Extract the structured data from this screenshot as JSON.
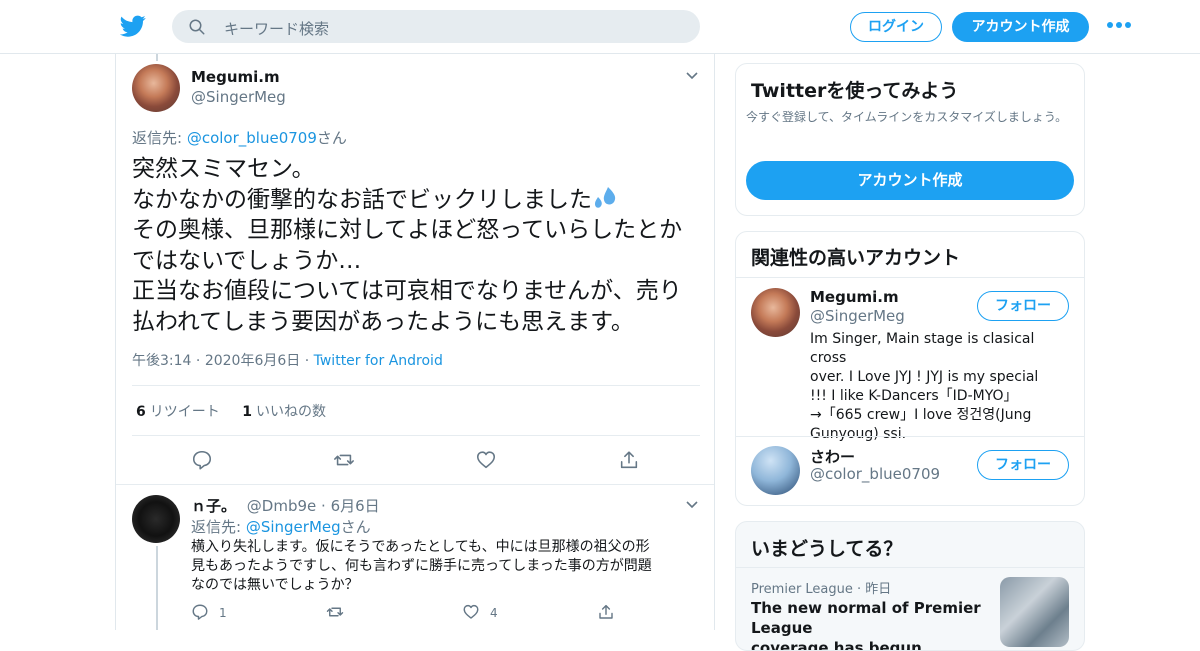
{
  "header": {
    "search_placeholder": "キーワード検索",
    "login_label": "ログイン",
    "signup_label": "アカウント作成",
    "brand_color": "#1da1f2"
  },
  "main_tweet": {
    "name": "Megumi.m",
    "handle": "@SingerMeg",
    "reply_prefix": "返信先: ",
    "reply_handle": "@color_blue0709",
    "reply_suffix": "さん",
    "lines": [
      "突然スミマセン。",
      "なかなかの衝撃的なお話でビックリしました",
      "その奥様、旦那様に対してよほど怒っていらしたとか",
      "ではないでしょうか…",
      "正当なお値段については可哀相でなりませんが、売り",
      "払われてしまう要因があったようにも思えます。"
    ],
    "time": "午後3:14",
    "date": "2020年6月6日",
    "source": "Twitter for Android",
    "retweet_count": "6",
    "retweet_label": "リツイート",
    "like_count": "1",
    "like_label": "いいねの数"
  },
  "reply_tweet": {
    "name": "ｎ子。",
    "handle": "@Dmb9e",
    "date": "6月6日",
    "reply_prefix": "返信先: ",
    "reply_handle": "@SingerMeg",
    "reply_suffix": "さん",
    "lines": [
      "横入り失礼します。仮にそうであったとしても、中には旦那様の祖父の形",
      "見もあったようですし、何も言わずに勝手に売ってしまった事の方が問題",
      "なのでは無いでしょうか？"
    ],
    "reply_count": "1",
    "like_count": "4"
  },
  "sidebar": {
    "try_twitter": {
      "title": "Twitterを使ってみよう",
      "subtitle": "今すぐ登録して、タイムラインをカスタマイズしましょう。",
      "button_label": "アカウント作成"
    },
    "related": {
      "title": "関連性の高いアカウント",
      "follow_label": "フォロー",
      "accounts": [
        {
          "name": "Megumi.m",
          "handle": "@SingerMeg",
          "bio_lines": [
            "Im Singer, Main stage is clasical cross",
            "over. I Love JYJ ! JYJ is my special",
            "!!! I like K-Dancers「ID-MYO」",
            "→「665 crew」I love 정건영(Jung",
            "Gunyoug) ssi."
          ]
        },
        {
          "name": "さわー",
          "handle": "@color_blue0709"
        }
      ]
    },
    "trends": {
      "title": "いまどうしてる？",
      "category": "Premier League",
      "time": "昨日",
      "headline_lines": [
        "The new normal of Premier League",
        "coverage has begun"
      ]
    }
  }
}
